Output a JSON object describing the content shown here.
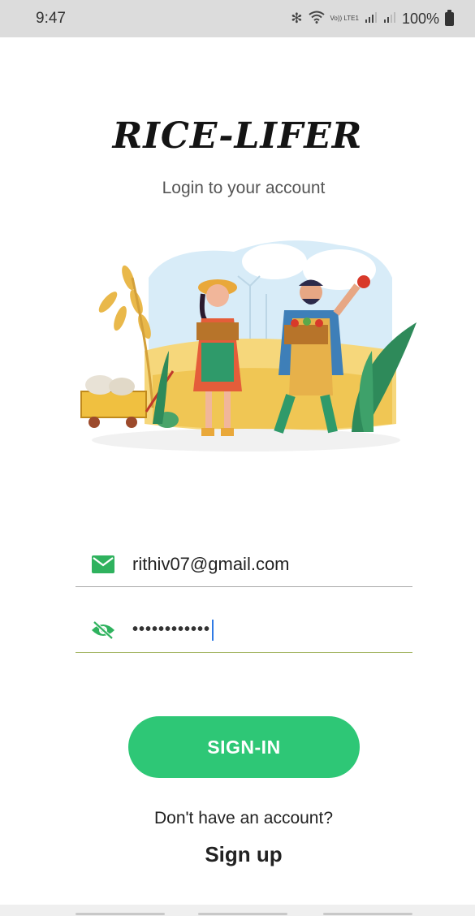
{
  "status_bar": {
    "time": "9:47",
    "network_label": "Vo)) LTE1",
    "battery_text": "100%"
  },
  "header": {
    "title": "RICE-LIFER",
    "subtitle": "Login to your account"
  },
  "illustration": {
    "description_icon": "farmers-illustration"
  },
  "form": {
    "email_value": "rithiv07@gmail.com",
    "password_masked": "••••••••••••"
  },
  "actions": {
    "signin_label": "SIGN-IN",
    "no_account_text": "Don't have an account?",
    "signup_label": "Sign up"
  },
  "colors": {
    "accent_green": "#2ec776",
    "icon_green": "#2fb25e"
  }
}
